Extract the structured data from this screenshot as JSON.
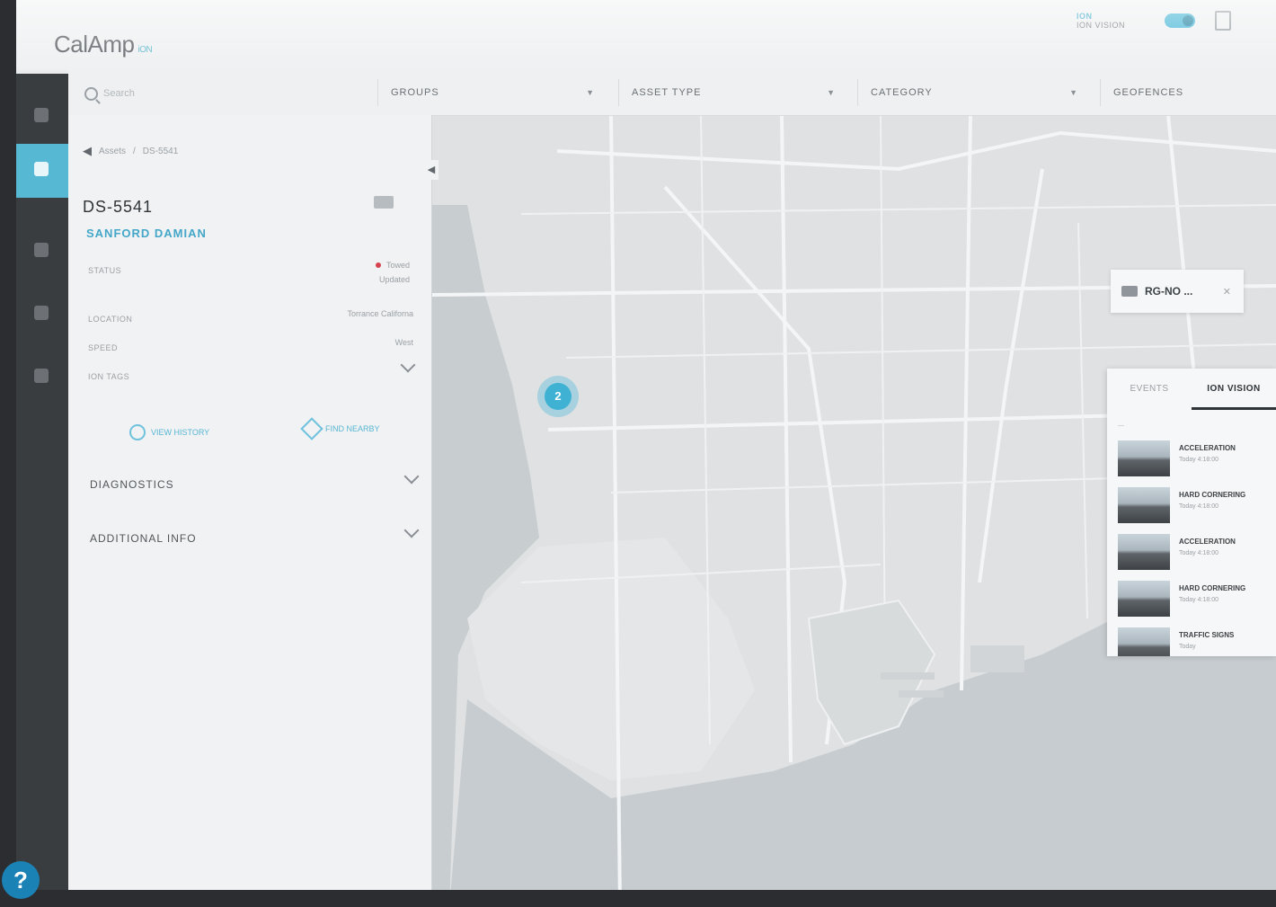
{
  "header": {
    "logo": "CalAmp",
    "logo_sub": "iON",
    "ion_vision_label_1": "iON",
    "ion_vision_label_2": "iON VISION"
  },
  "filters": {
    "search_placeholder": "Search",
    "groups": "GROUPS",
    "asset_type": "ASSET TYPE",
    "category": "CATEGORY",
    "geofences": "GEOFENCES"
  },
  "panel": {
    "breadcrumb_parent": "Assets",
    "breadcrumb_sep": "/",
    "breadcrumb_current": "DS-5541",
    "asset_id": "DS-5541",
    "driver": "SANFORD DAMIAN",
    "status_label": "STATUS",
    "status_value": "Towed",
    "status_sub": "Updated",
    "location_label": "LOCATION",
    "location_value": "Torrance Californa",
    "speed_label": "SPEED",
    "speed_value": "West",
    "ion_tags_label": "iON TAGS",
    "view_history": "VIEW HISTORY",
    "find_nearby": "FIND NEARBY",
    "diagnostics": "DIAGNOSTICS",
    "additional_info": "ADDITIONAL INFO"
  },
  "map": {
    "cluster_count": "2",
    "tooltip_label": "RG-NO ..."
  },
  "events_panel": {
    "tabs": [
      "EVENTS",
      "iON VISION"
    ],
    "active_tab": "iON VISION",
    "date_header": "—",
    "items": [
      {
        "title": "ACCELERATION",
        "time": "Today 4:18:00"
      },
      {
        "title": "HARD CORNERING",
        "time": "Today 4:18:00"
      },
      {
        "title": "ACCELERATION",
        "time": "Today 4:18:00"
      },
      {
        "title": "HARD CORNERING",
        "time": "Today 4:18:00"
      },
      {
        "title": "TRAFFIC SIGNS",
        "time": "Today"
      }
    ]
  },
  "help": "?",
  "colors": {
    "accent": "#3fb2d4",
    "nav_bg": "#3a3d40",
    "status_red": "#d6424f"
  }
}
